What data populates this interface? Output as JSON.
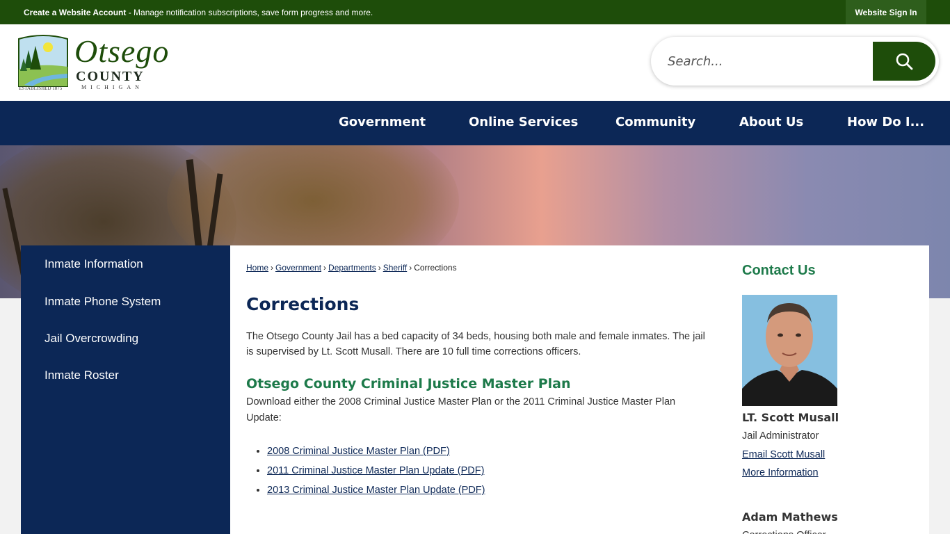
{
  "topbar": {
    "account_bold": "Create a Website Account",
    "account_rest": " - Manage notification subscriptions, save form progress and more.",
    "signin_label": "Website Sign In"
  },
  "logo": {
    "word": "Otsego",
    "county": "COUNTY",
    "state": "MICHIGAN",
    "established": "ESTABLISHED 1875"
  },
  "search": {
    "placeholder": "Search..."
  },
  "nav": {
    "items": [
      "Government",
      "Online Services",
      "Community",
      "About Us",
      "How Do I..."
    ]
  },
  "sidebar": {
    "items": [
      "Inmate Information",
      "Inmate Phone System",
      "Jail Overcrowding",
      "Inmate Roster"
    ]
  },
  "breadcrumb": {
    "links": [
      "Home",
      "Government",
      "Departments",
      "Sheriff"
    ],
    "current": "Corrections",
    "separator": "›"
  },
  "page": {
    "title": "Corrections",
    "intro": "The Otsego County Jail has a bed capacity of 34 beds, housing both male and female inmates. The jail is supervised by Lt. Scott Musall. There are 10 full time corrections officers.",
    "subhead": "Otsego County Criminal Justice Master Plan",
    "download_text": "Download either the 2008 Criminal Justice Master Plan or the 2011 Criminal Justice Master Plan Update:",
    "documents": [
      "2008 Criminal Justice Master Plan (PDF)",
      "2011 Criminal Justice Master Plan Update (PDF)",
      "2013 Criminal Justice Master Plan Update (PDF)"
    ]
  },
  "contact": {
    "heading": "Contact Us",
    "person1": {
      "name": "LT. Scott Musall",
      "role": "Jail Administrator",
      "email_label": "Email Scott Musall",
      "more_label": "More Information"
    },
    "person2": {
      "name": "Adam Mathews",
      "role": "Corrections Officer"
    }
  },
  "colors": {
    "green": "#1e4d0a",
    "navy": "#0c2756",
    "accent_green": "#1d7a4a"
  }
}
